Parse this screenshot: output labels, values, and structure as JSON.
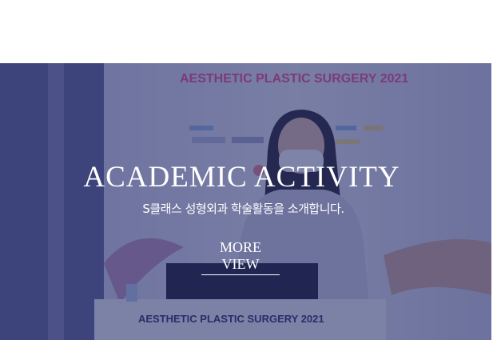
{
  "banner": {
    "title": "ACADEMIC ACTIVITY",
    "subtitle": "S클래스 성형외과 학술활동을 소개합니다.",
    "more_label": "MORE VIEW"
  },
  "photo": {
    "backdrop_heading": "AESTHETIC PLASTIC SURGERY 2021",
    "podium_heading": "AESTHETIC PLASTIC SURGERY 2021"
  },
  "colors": {
    "overlay": "#242c68",
    "banner_bg": "#3d4476",
    "text": "#ffffff"
  }
}
